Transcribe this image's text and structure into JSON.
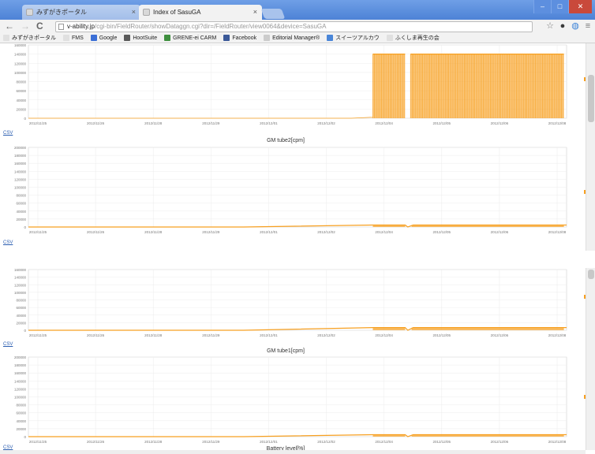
{
  "browser": {
    "tabs": [
      {
        "label": "みずがきポータル",
        "active": false
      },
      {
        "label": "Index of SasuGA",
        "active": true
      }
    ],
    "window_buttons": {
      "minimize": "–",
      "maximize": "□",
      "close": "✕"
    },
    "address": {
      "host": "v-ability.jp",
      "path": "/cgi-bin/FieldRouter/showDataggn.cgi?dir=/FieldRouter/view0064&device=SasuGA"
    },
    "bookmarks": [
      {
        "label": "みずがきポータル",
        "icon": "page-icon",
        "color": "#e0e0e0"
      },
      {
        "label": "FMS",
        "icon": "page-icon",
        "color": "#e0e0e0"
      },
      {
        "label": "Google",
        "icon": "google-icon",
        "color": "#3b6fd6"
      },
      {
        "label": "HootSuite",
        "icon": "hootsuite-icon",
        "color": "#5a5a5a"
      },
      {
        "label": "GRENE-ei CARM",
        "icon": "leaf-icon",
        "color": "#3f8f3f"
      },
      {
        "label": "Facebook",
        "icon": "facebook-icon",
        "color": "#3b5998"
      },
      {
        "label": "Editorial Manager®",
        "icon": "em-icon",
        "color": "#cccccc"
      },
      {
        "label": "スイーツアルカウ",
        "icon": "blue-icon",
        "color": "#4a86d8"
      },
      {
        "label": "ふくしま再生の会",
        "icon": "page-icon",
        "color": "#e0e0e0"
      }
    ]
  },
  "common": {
    "csv_label": "CSV",
    "x_ticks": [
      "2012/11/25",
      "2012/11/26",
      "2012/11/28",
      "2012/11/29",
      "2012/12/01",
      "2012/12/02",
      "2012/12/04",
      "2012/12/05",
      "2012/12/06",
      "2012/12/08"
    ],
    "series_color": "#f7a021"
  },
  "titles": {
    "gm2": "GM tube2[cpm]",
    "gm1": "GM tube1[cpm]",
    "battery": "Battery level[%]"
  },
  "chart_data": [
    {
      "type": "area",
      "title": "",
      "ylim": [
        0,
        160000
      ],
      "y_ticks": [
        "160000",
        "140000",
        "120000",
        "100000",
        "80000",
        "60000",
        "40000",
        "20000",
        "0"
      ],
      "series": [
        {
          "values": [
            0,
            0,
            0,
            0,
            0,
            2000,
            140000,
            0,
            140000,
            140000,
            140000
          ]
        }
      ],
      "x_positions": [
        0,
        0.2,
        0.4,
        0.6,
        0.64,
        0.655,
        0.66,
        0.7,
        0.71,
        0.95,
        1
      ]
    },
    {
      "type": "area",
      "title": "GM tube2[cpm]",
      "ylim": [
        0,
        200000
      ],
      "y_ticks": [
        "200000",
        "180000",
        "160000",
        "140000",
        "120000",
        "100000",
        "80000",
        "60000",
        "40000",
        "20000",
        "0"
      ],
      "series": [
        {
          "values": [
            0,
            0,
            0,
            5000,
            5000,
            0,
            5000,
            5000
          ]
        }
      ]
    },
    {
      "type": "area",
      "title": "",
      "ylim": [
        0,
        160000
      ],
      "y_ticks": [
        "160000",
        "140000",
        "120000",
        "100000",
        "80000",
        "60000",
        "40000",
        "20000",
        "0"
      ],
      "series": [
        {
          "values": [
            0,
            0,
            0,
            7000,
            7000,
            0,
            7000,
            7000
          ]
        }
      ]
    },
    {
      "type": "area",
      "title": "GM tube1[cpm]",
      "ylim": [
        0,
        200000
      ],
      "y_ticks": [
        "200000",
        "180000",
        "160000",
        "140000",
        "120000",
        "100000",
        "80000",
        "60000",
        "40000",
        "20000",
        "0"
      ],
      "series": [
        {
          "values": [
            0,
            0,
            0,
            5000,
            5000,
            0,
            5000,
            5000
          ]
        }
      ]
    }
  ]
}
